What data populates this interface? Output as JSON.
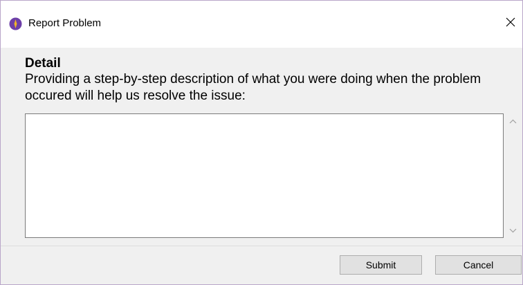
{
  "window": {
    "title": "Report Problem",
    "close_icon": "close-icon",
    "app_icon": "app-logo-icon"
  },
  "detail": {
    "heading": "Detail",
    "description": "Providing a step-by-step description of what you were doing when the problem occured will help us resolve the issue:",
    "textarea_value": ""
  },
  "scrollbar": {
    "up_icon": "chevron-up-icon",
    "down_icon": "chevron-down-icon"
  },
  "buttons": {
    "submit_label": "Submit",
    "cancel_label": "Cancel"
  },
  "colors": {
    "app_icon_fill": "#6d3fa8",
    "app_icon_accent": "#f0b428",
    "border": "#b9a6c9"
  }
}
